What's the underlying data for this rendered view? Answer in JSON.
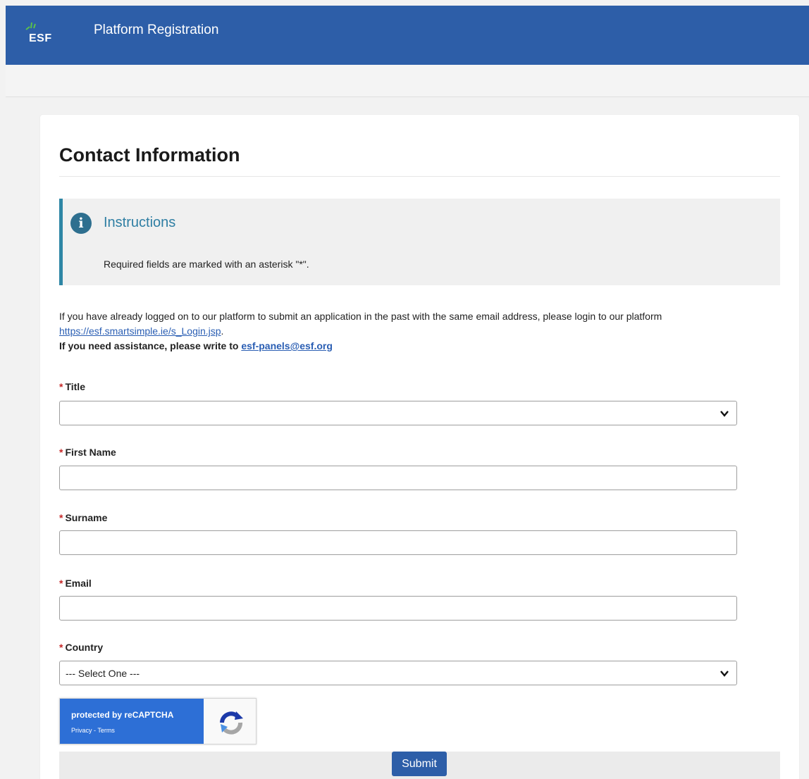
{
  "header": {
    "logo_text": "ESF",
    "title": "Platform Registration"
  },
  "section": {
    "title": "Contact Information"
  },
  "instructions": {
    "icon": "info-icon",
    "icon_glyph": "i",
    "heading": "Instructions",
    "text": "Required fields are marked with an asterisk \"*\"."
  },
  "intro": {
    "line1": "If you have already logged on to our platform to submit an application in the past with the same email address, please login to our platform",
    "login_link": "https://esf.smartsimple.ie/s_Login.jsp",
    "line1_end": ".",
    "assistance_text": "If you need assistance, please write to",
    "assistance_email": "esf-panels@esf.org"
  },
  "form": {
    "required_marker": "*",
    "title": {
      "label": "Title",
      "value": ""
    },
    "first_name": {
      "label": "First Name",
      "value": ""
    },
    "surname": {
      "label": "Surname",
      "value": ""
    },
    "email": {
      "label": "Email",
      "value": ""
    },
    "country": {
      "label": "Country",
      "value": "--- Select One ---"
    }
  },
  "recaptcha": {
    "text": "protected by reCAPTCHA",
    "privacy": "Privacy",
    "separator": " - ",
    "terms": "Terms"
  },
  "submit_label": "Submit",
  "colors": {
    "header_bg": "#2d5ea8",
    "accent": "#2e86a5",
    "required": "#c62828",
    "link": "#2a5eb3"
  }
}
